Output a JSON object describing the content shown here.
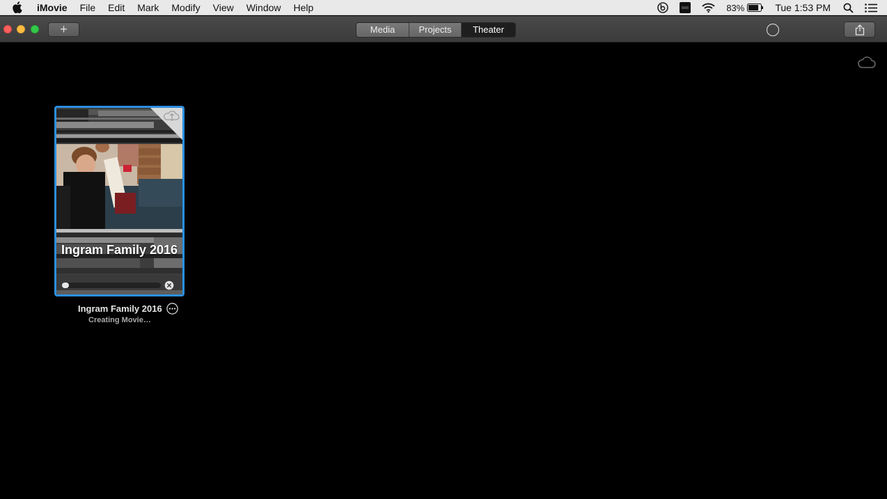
{
  "menubar": {
    "app_name": "iMovie",
    "items": [
      "File",
      "Edit",
      "Mark",
      "Modify",
      "View",
      "Window",
      "Help"
    ],
    "battery_percent": "83%",
    "clock": "Tue 1:53 PM",
    "battery_level": 0.83
  },
  "toolbar": {
    "add_label": "+",
    "tabs": [
      {
        "label": "Media",
        "selected": false
      },
      {
        "label": "Projects",
        "selected": false
      },
      {
        "label": "Theater",
        "selected": true
      }
    ]
  },
  "theater": {
    "project": {
      "poster_title": "Ingram Family 2016",
      "name": "Ingram Family 2016",
      "status": "Creating Movie…",
      "progress": 0.04
    }
  },
  "colors": {
    "selection_border": "#2b8fe0",
    "background": "#000000",
    "menubar": "#e9e9e9"
  },
  "icons": [
    "apple-icon",
    "beats-icon",
    "flash-icon",
    "wifi-icon",
    "battery-icon",
    "spotlight-search-icon",
    "notification-center-icon",
    "share-icon",
    "icloud-icon",
    "icloud-upload-icon",
    "cancel-icon",
    "more-icon"
  ]
}
